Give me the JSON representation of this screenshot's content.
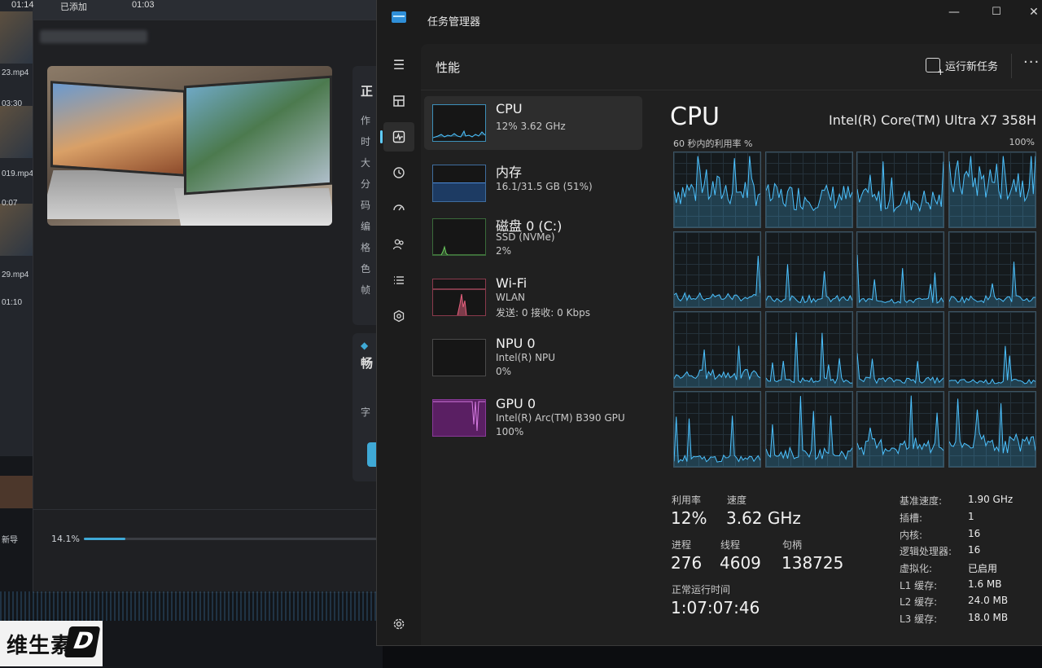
{
  "background_app": {
    "top_labels": [
      "01:14",
      "已添加",
      "01:03"
    ],
    "strip_labels": [
      "23.mp4",
      "03:30",
      "019.mp4",
      "0:07",
      "29.mp4",
      "01:10"
    ],
    "side_chars": [
      "正",
      "作",
      "时",
      "大",
      "分",
      "码",
      "编",
      "格",
      "色",
      "帧"
    ],
    "card_chars": [
      "畅",
      "字"
    ],
    "bottom_labels": [
      "新导"
    ],
    "progress_text": "14.1%",
    "progress_value": 0.141,
    "watermark_text": "维生素"
  },
  "task_manager": {
    "window_title": "任务管理器",
    "window_buttons": {
      "minimize": "—",
      "maximize": "☐",
      "close": "✕"
    },
    "page_title": "性能",
    "run_new_task": "运行新任务",
    "more": "···",
    "resources": [
      {
        "name": "CPU",
        "line1": "12%  3.62 GHz",
        "line2": "",
        "color": "#4cc2ff"
      },
      {
        "name": "内存",
        "line1": "16.1/31.5 GB (51%)",
        "line2": "",
        "color": "#4c8bd9"
      },
      {
        "name": "磁盘 0 (C:)",
        "line1": "SSD (NVMe)",
        "line2": "2%",
        "color": "#6ccb5f"
      },
      {
        "name": "Wi-Fi",
        "line1": "WLAN",
        "line2": "发送: 0 接收: 0 Kbps",
        "color": "#e6607e"
      },
      {
        "name": "NPU 0",
        "line1": "Intel(R) NPU",
        "line2": "0%",
        "color": "#4cc2ff"
      },
      {
        "name": "GPU 0",
        "line1": "Intel(R) Arc(TM) B390 GPU",
        "line2": "100%",
        "color": "#b146c2"
      }
    ],
    "detail": {
      "title": "CPU",
      "model": "Intel(R) Core(TM) Ultra X7 358H",
      "graph_label": "60 秒内的利用率 %",
      "graph_max": "100%",
      "stats": {
        "utilization_label": "利用率",
        "utilization": "12%",
        "speed_label": "速度",
        "speed": "3.62 GHz",
        "processes_label": "进程",
        "processes": "276",
        "threads_label": "线程",
        "threads": "4609",
        "handles_label": "句柄",
        "handles": "138725",
        "uptime_label": "正常运行时间",
        "uptime": "1:07:07:46"
      },
      "specs": [
        {
          "k": "基准速度:",
          "v": "1.90 GHz"
        },
        {
          "k": "插槽:",
          "v": "1"
        },
        {
          "k": "内核:",
          "v": "16"
        },
        {
          "k": "逻辑处理器:",
          "v": "16"
        },
        {
          "k": "虚拟化:",
          "v": "已启用"
        },
        {
          "k": "L1 缓存:",
          "v": "1.6 MB"
        },
        {
          "k": "L2 缓存:",
          "v": "24.0 MB"
        },
        {
          "k": "L3 缓存:",
          "v": "18.0 MB"
        }
      ]
    }
  }
}
